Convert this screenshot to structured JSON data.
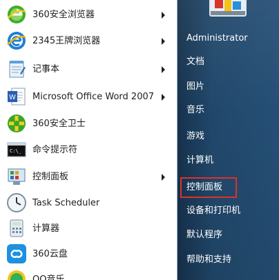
{
  "programs": [
    {
      "label": "360安全浏览器",
      "arrow": true
    },
    {
      "label": "2345王牌浏览器",
      "arrow": true
    },
    {
      "label": "记事本",
      "arrow": true
    },
    {
      "label": "Microsoft Office Word 2007",
      "arrow": true
    },
    {
      "label": "360安全卫士",
      "arrow": false
    },
    {
      "label": "命令提示符",
      "arrow": false
    },
    {
      "label": "控制面板",
      "arrow": true
    },
    {
      "label": "Task Scheduler",
      "arrow": false
    },
    {
      "label": "计算器",
      "arrow": false
    },
    {
      "label": "360云盘",
      "arrow": false
    },
    {
      "label": "QQ音乐",
      "arrow": false
    }
  ],
  "right_panel": {
    "items": [
      "Administrator",
      "文档",
      "图片",
      "音乐",
      "游戏",
      "计算机",
      "控制面板",
      "设备和打印机",
      "默认程序",
      "帮助和支持"
    ],
    "selected": "控制面板"
  },
  "colors": {
    "highlight_border": "#e0302a",
    "right_panel": "#21486b"
  }
}
